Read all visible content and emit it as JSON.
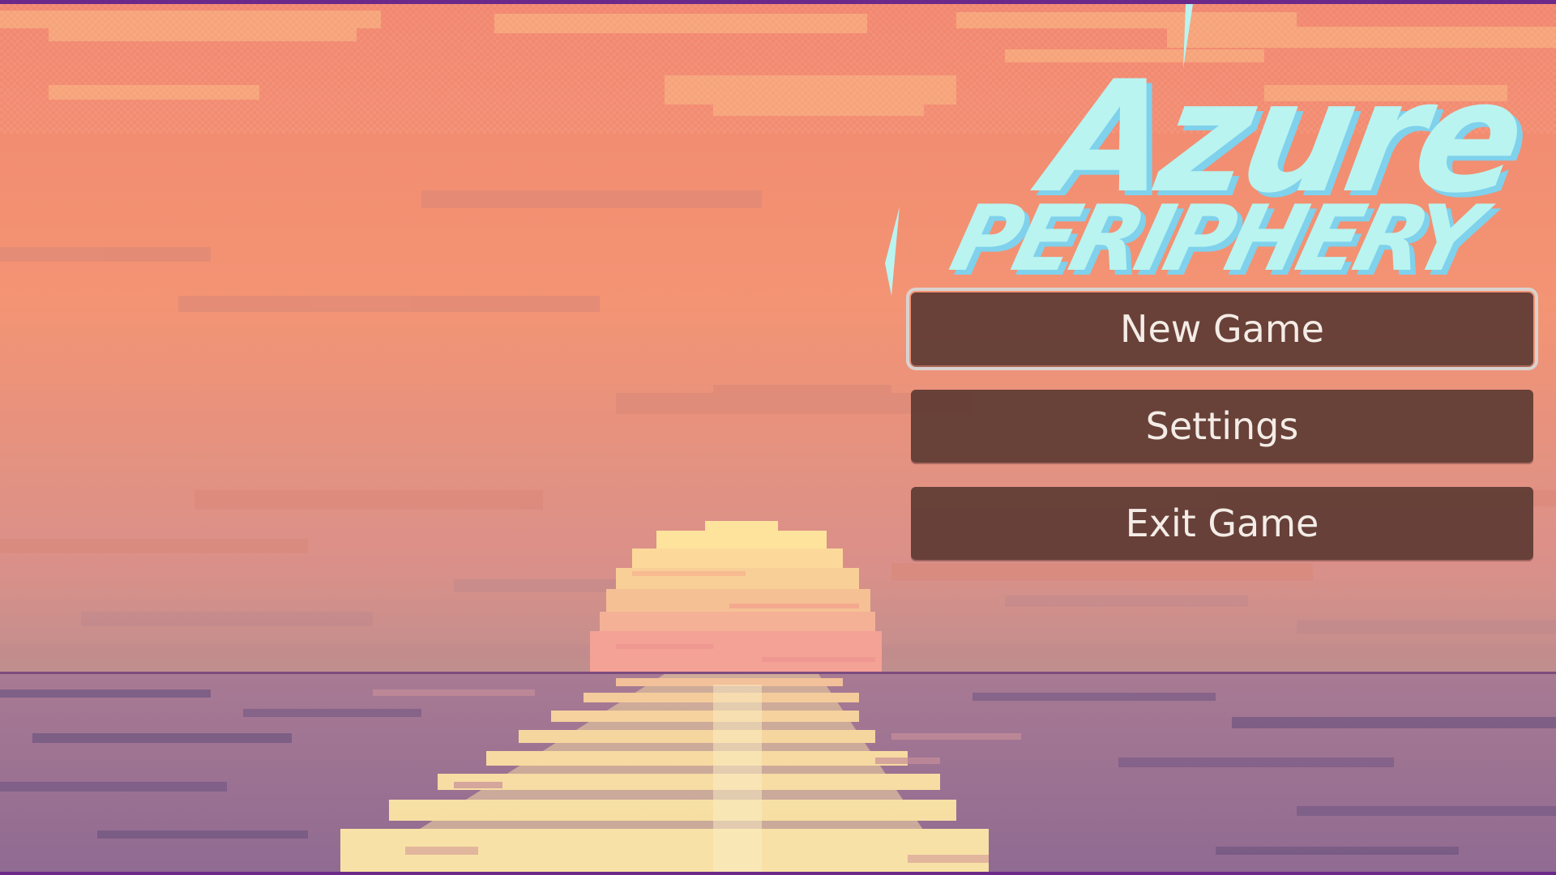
{
  "game": {
    "title_line1": "Azure",
    "title_line2": "PERIPHERY"
  },
  "menu": {
    "items": [
      {
        "label": "New Game",
        "selected": true
      },
      {
        "label": "Settings",
        "selected": false
      },
      {
        "label": "Exit Game",
        "selected": false
      }
    ]
  },
  "colors": {
    "sky_top": "#f28a72",
    "sky_mid": "#f49878",
    "sky_horizon": "#cf8f8a",
    "sea_deep": "#7e5e8a",
    "sea_mid": "#a4718f",
    "sun": "#fde39b",
    "reflection": "#fbe3a0",
    "logo_face": "#b9f4f0",
    "logo_shadow": "#7fd1ec",
    "button_bg": "#603c34",
    "button_text": "#f4ece6",
    "frame": "#6b2a8a"
  }
}
